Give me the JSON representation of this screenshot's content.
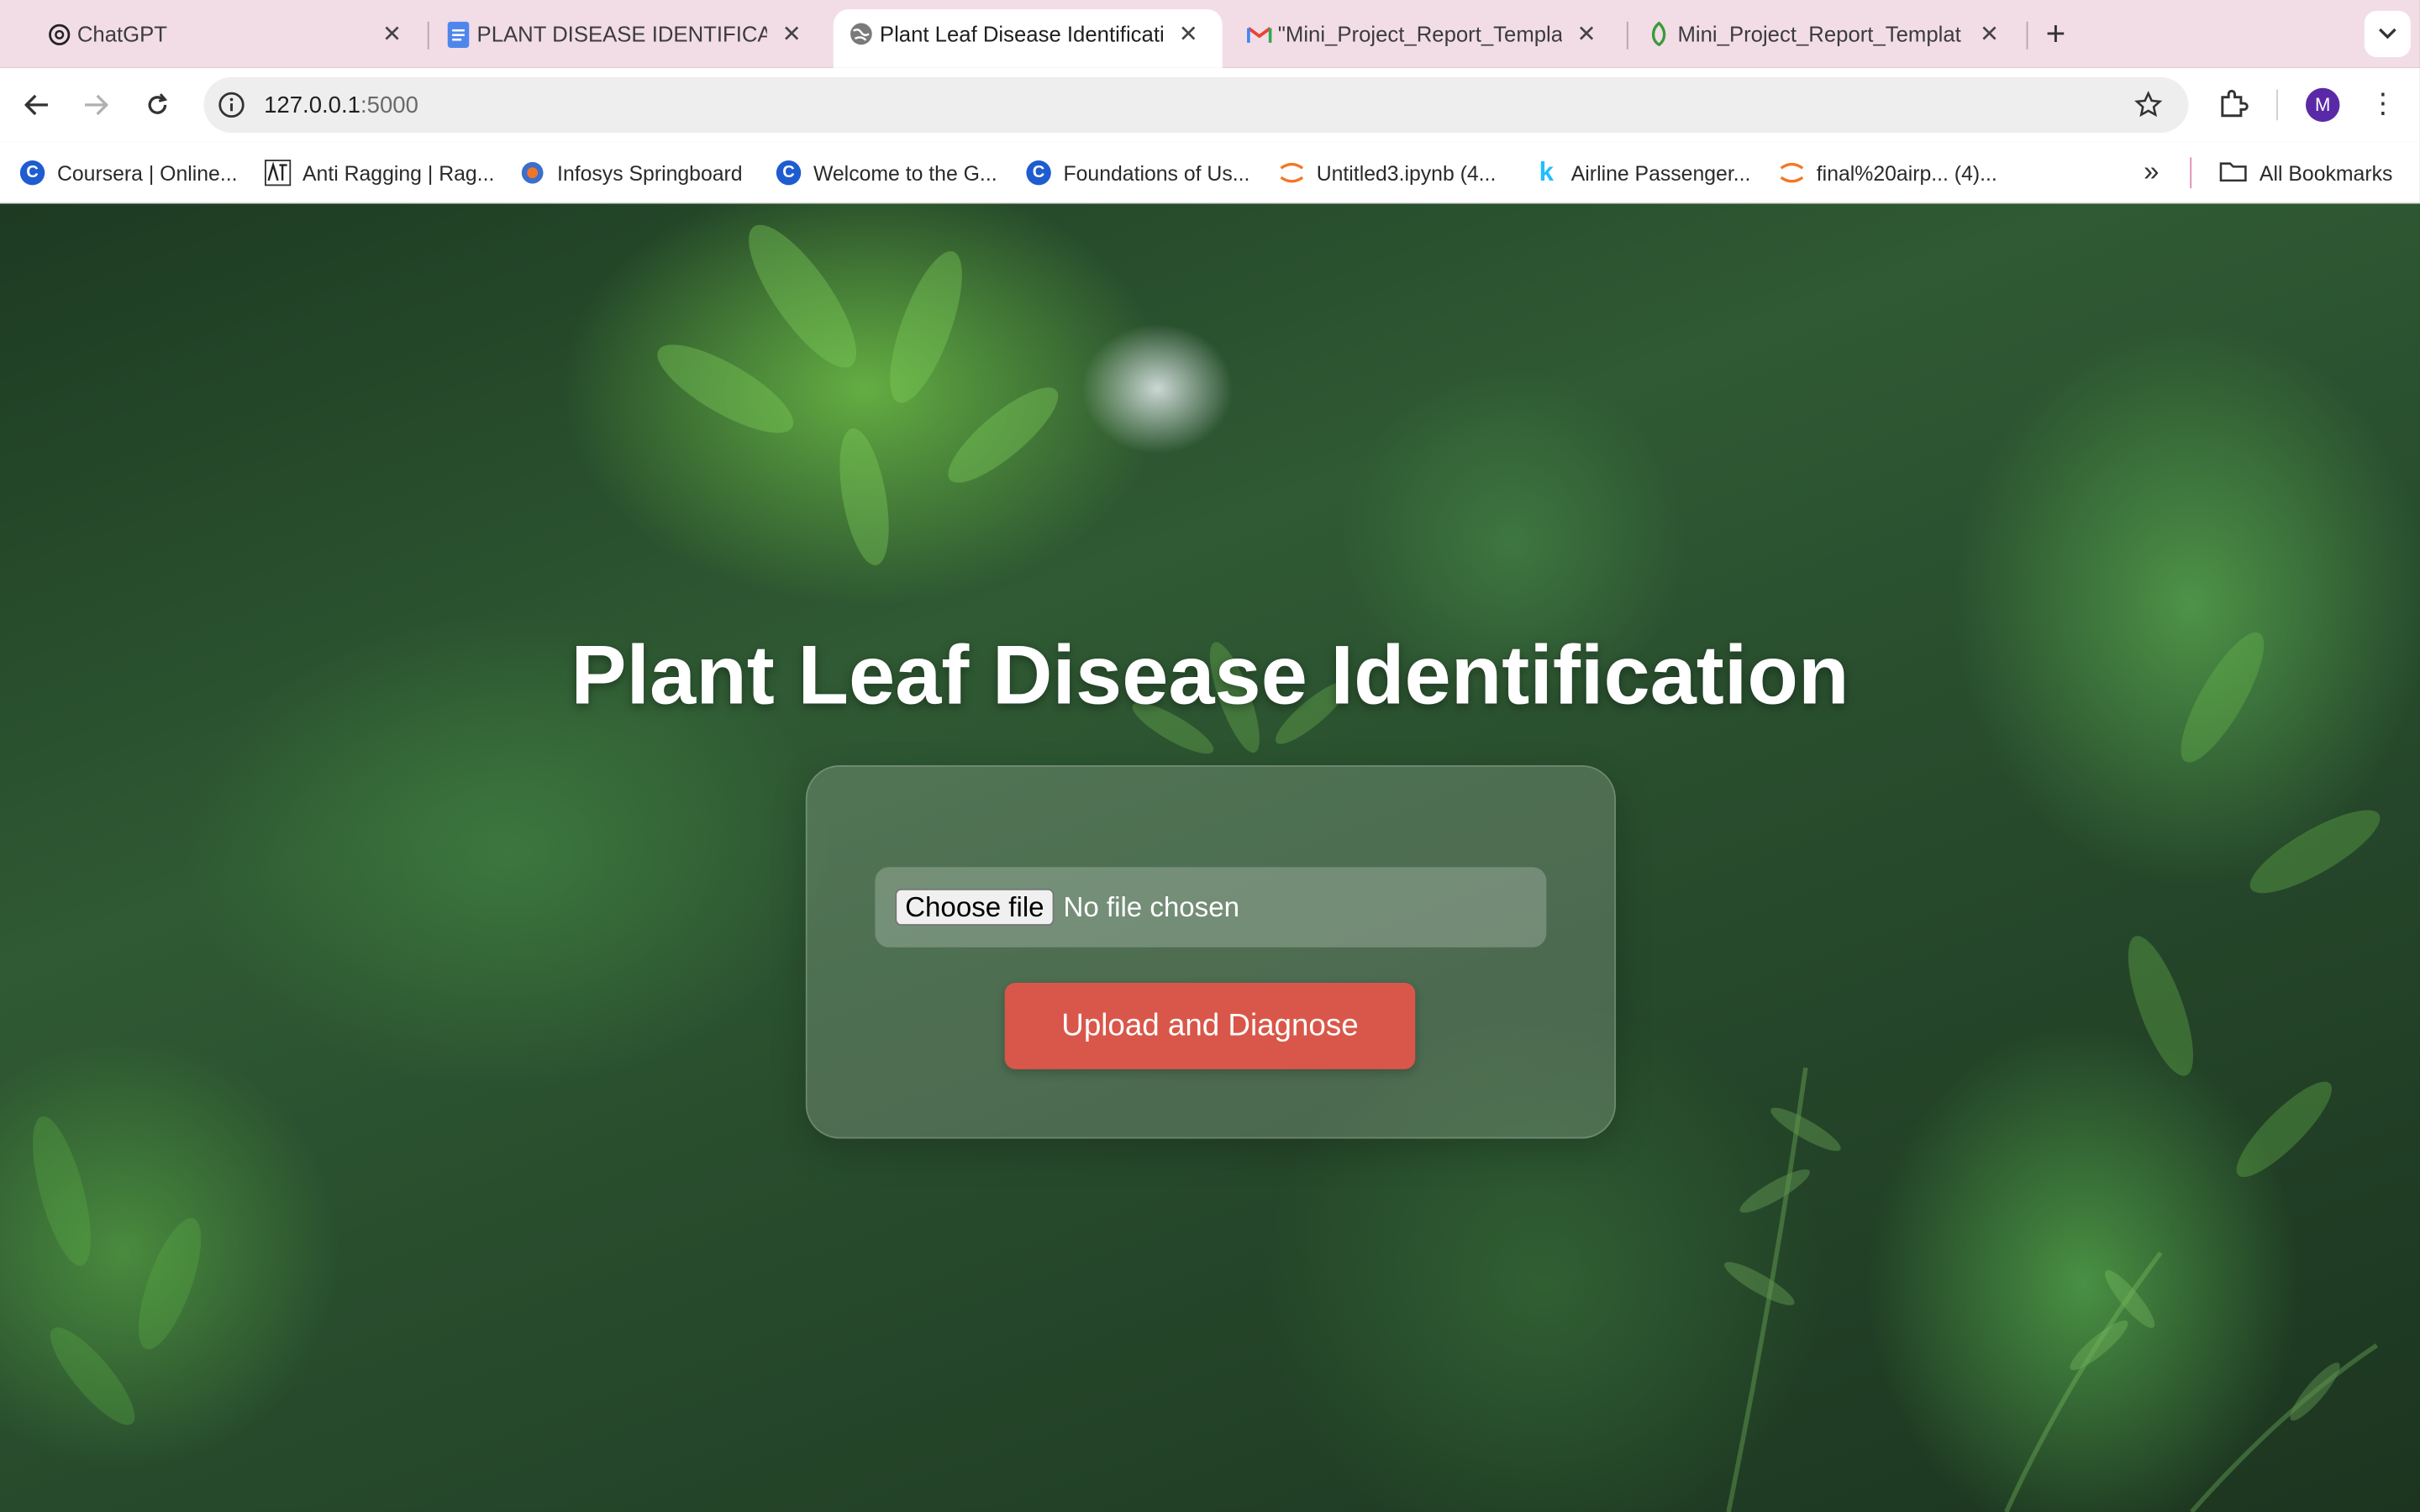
{
  "tabs": [
    {
      "title": "ChatGPT",
      "icon": "openai-icon",
      "active": false
    },
    {
      "title": "PLANT DISEASE IDENTIFICATI",
      "icon": "google-docs-icon",
      "active": false
    },
    {
      "title": "Plant Leaf Disease Identificati",
      "icon": "globe-icon",
      "active": true
    },
    {
      "title": "\"Mini_Project_Report_Templa",
      "icon": "gmail-icon",
      "active": false
    },
    {
      "title": "Mini_Project_Report_Templat",
      "icon": "overleaf-icon",
      "active": false
    }
  ],
  "toolbar": {
    "url_host": "127.0.0.1",
    "url_port": ":5000",
    "profile_initial": "M"
  },
  "bookmarks": [
    {
      "label": "Coursera | Online...",
      "icon": "coursera-icon"
    },
    {
      "label": "Anti Ragging | Rag...",
      "icon": "anti-ragging-icon"
    },
    {
      "label": "Infosys Springboard",
      "icon": "infosys-icon"
    },
    {
      "label": "Welcome to the G...",
      "icon": "coursera-icon"
    },
    {
      "label": "Foundations of Us...",
      "icon": "coursera-icon"
    },
    {
      "label": "Untitled3.ipynb (4...",
      "icon": "jupyter-icon"
    },
    {
      "label": "Airline Passenger...",
      "icon": "kaggle-icon"
    },
    {
      "label": "final%20airp... (4)...",
      "icon": "jupyter-icon"
    }
  ],
  "all_bookmarks_label": "All Bookmarks",
  "page": {
    "title": "Plant Leaf Disease Identification",
    "choose_file_label": "Choose file",
    "no_file_text": "No file chosen",
    "submit_label": "Upload and Diagnose"
  },
  "colors": {
    "tab_strip": "#f2dde6",
    "submit_button": "#d9574a",
    "avatar": "#5a2aa6"
  }
}
